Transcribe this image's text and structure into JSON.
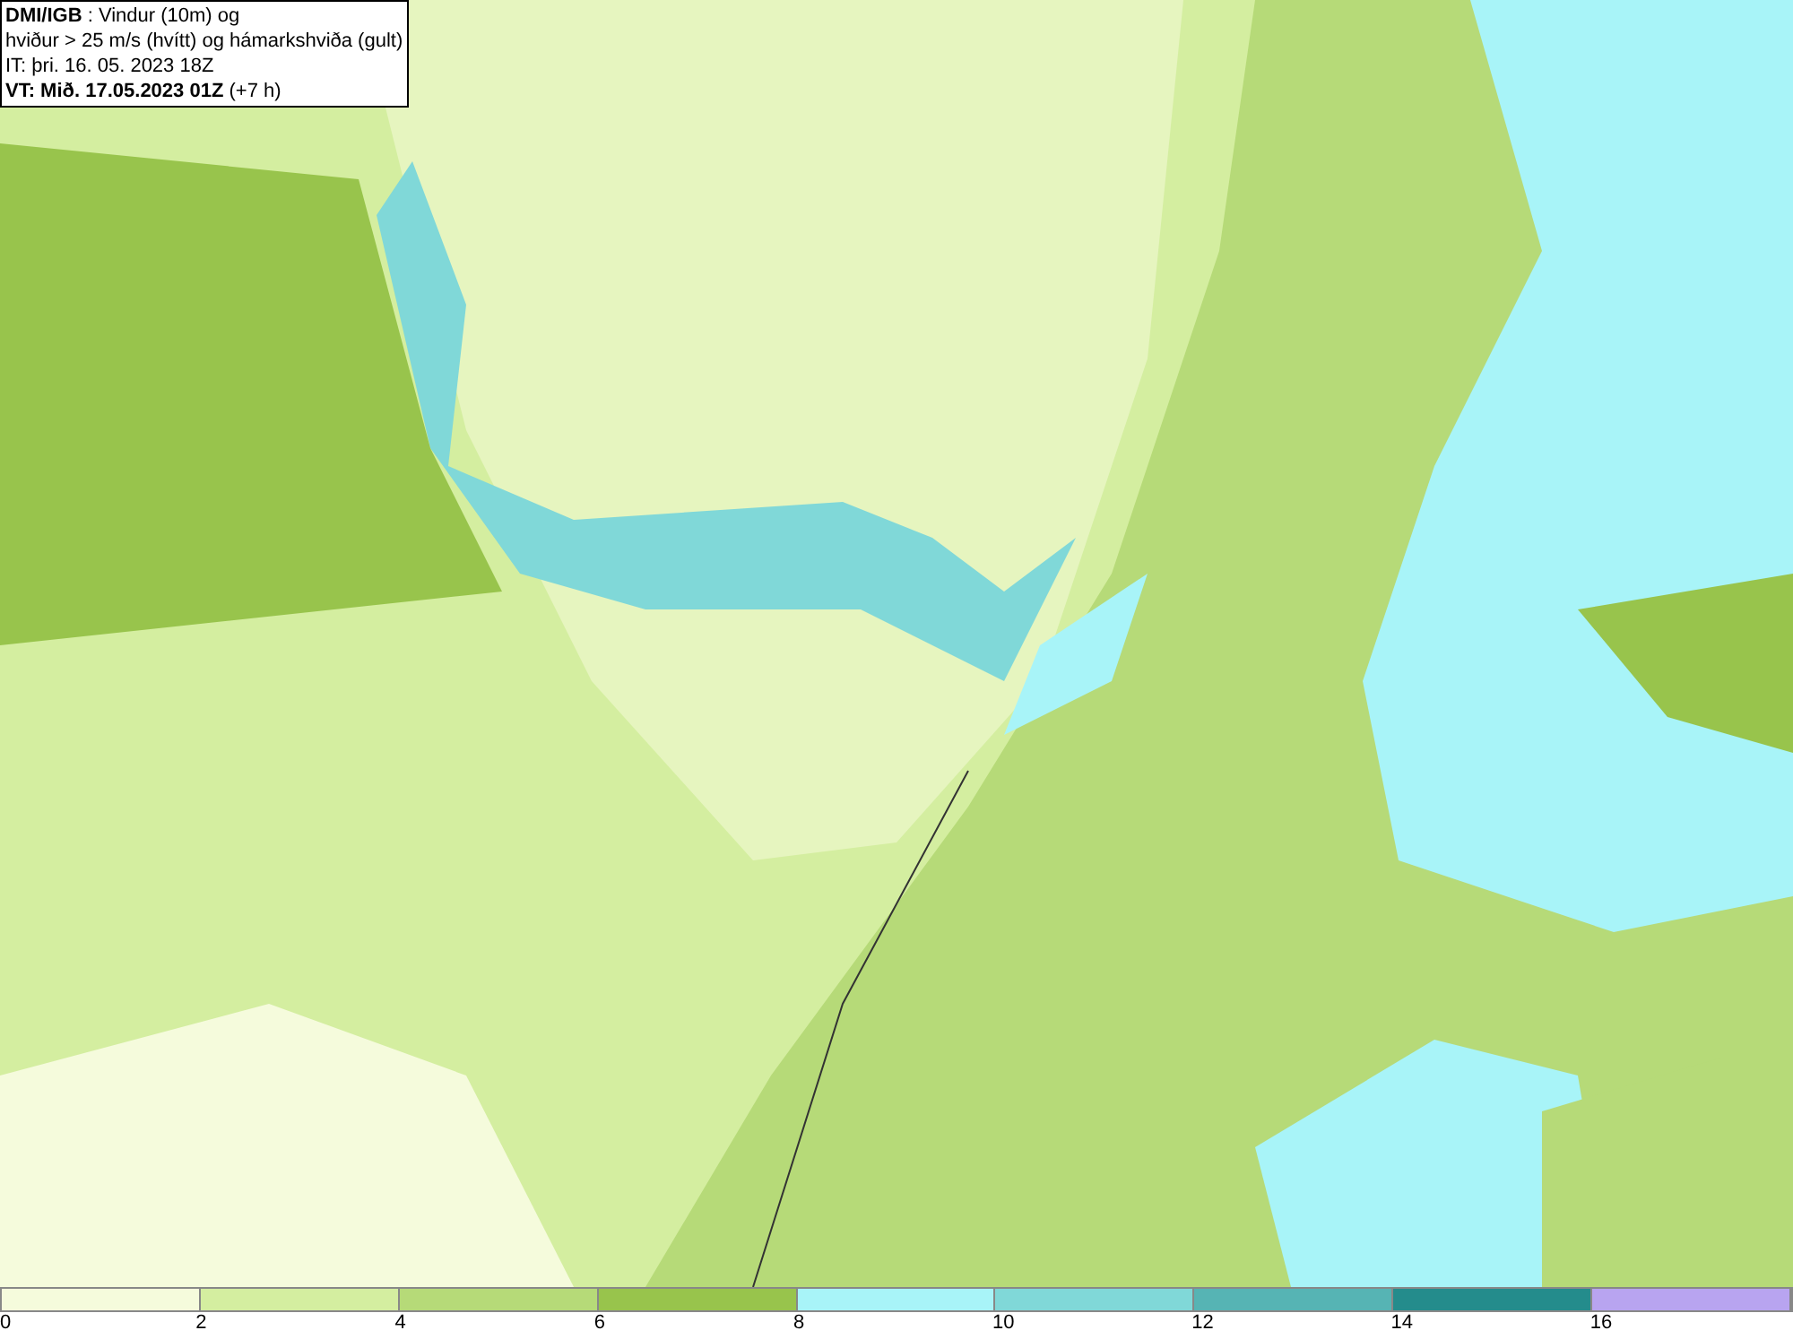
{
  "title_box": {
    "lines": [
      "**DMI/IGB** : Vindur (10m) og",
      "hviður > 25 m/s (hvítt) og hámarkshviða (gult)",
      "IT: þri. 16. 05. 2023 18Z",
      "**VT: Mið. 17.05.2023 01Z** (+7 h)"
    ]
  },
  "legend": {
    "bins": [
      {
        "color": "#f5fbdc"
      },
      {
        "color": "#d4eea0"
      },
      {
        "color": "#b6da78"
      },
      {
        "color": "#98c44c"
      },
      {
        "color": "#a8f4f8"
      },
      {
        "color": "#80d8d8"
      },
      {
        "color": "#56b4b4"
      },
      {
        "color": "#248c8c"
      },
      {
        "color": "#b8a4f0"
      }
    ],
    "ticks": [
      "0",
      "2",
      "4",
      "6",
      "8",
      "10",
      "12",
      "14",
      "16"
    ]
  }
}
